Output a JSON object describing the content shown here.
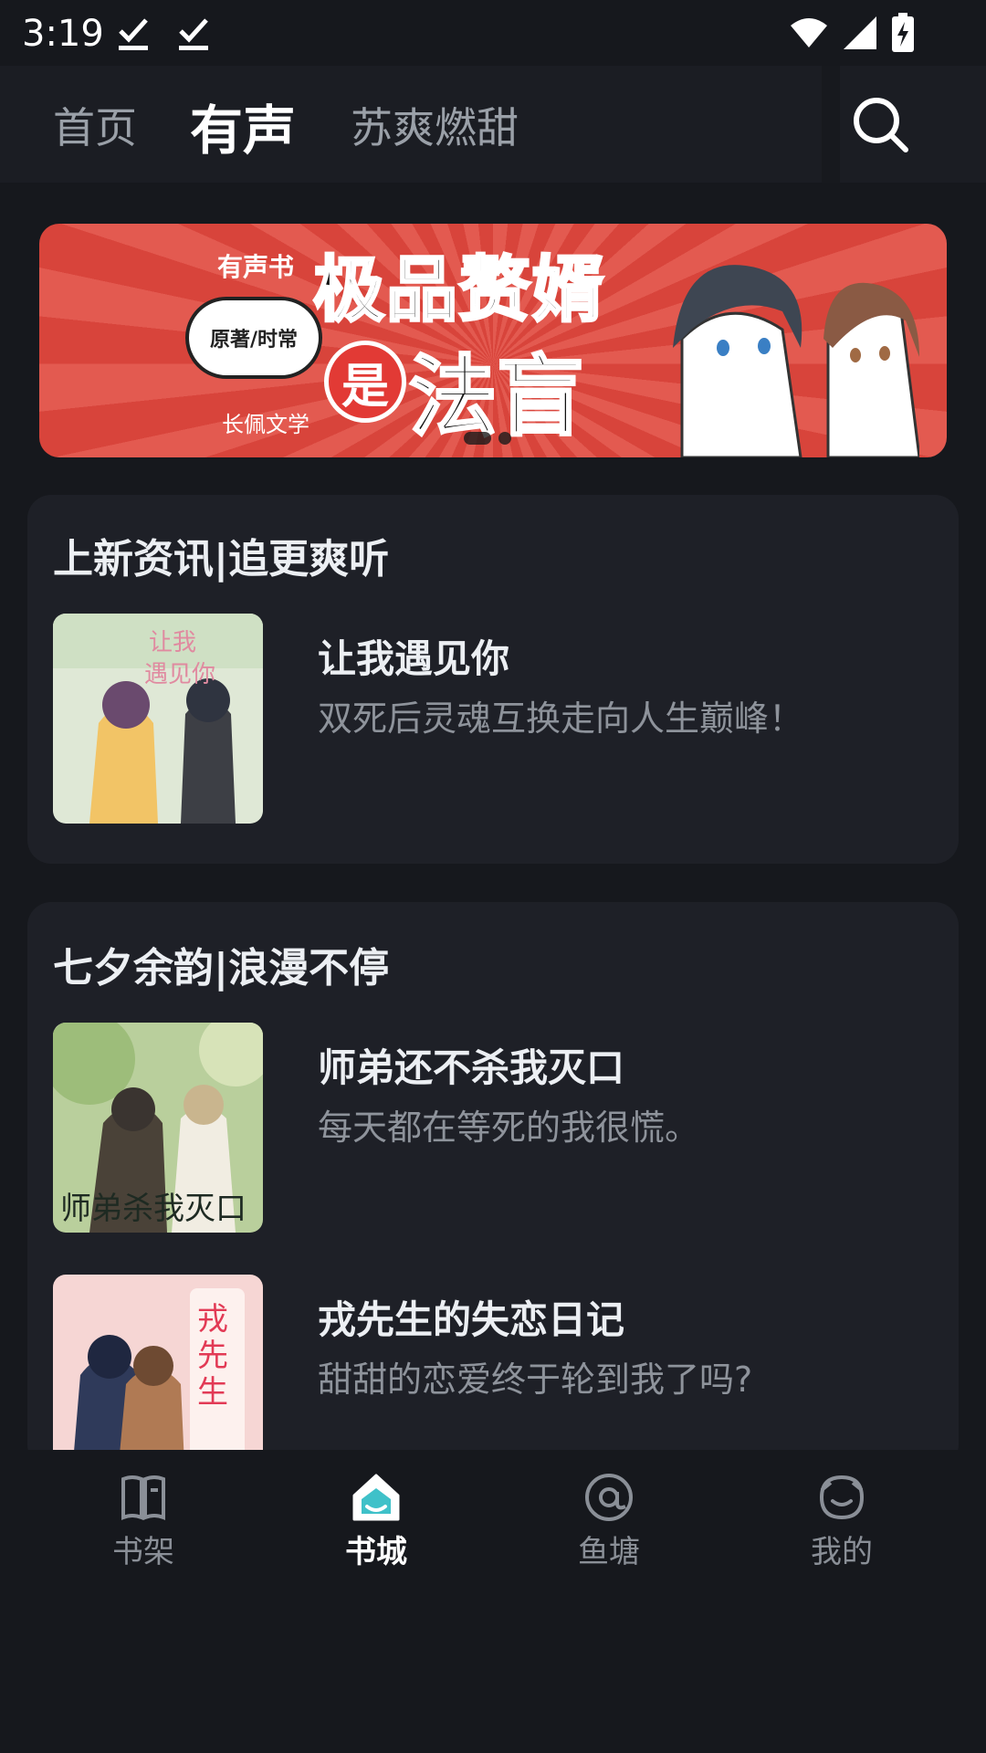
{
  "status_bar": {
    "time": "3:19"
  },
  "top_nav": {
    "tabs": [
      {
        "label": "首页",
        "active": false
      },
      {
        "label": "有声",
        "active": true
      },
      {
        "label": "苏爽燃甜",
        "active": false
      }
    ]
  },
  "banner": {
    "tag": "有声书",
    "author_note": "原著/时常",
    "title_line1": "极品赘婿",
    "badge": "是",
    "title_line2": "法盲",
    "publisher": "长佩文学",
    "slide_count": 2,
    "active_slide": 1
  },
  "sections": [
    {
      "title": "上新资讯|追更爽听",
      "books": [
        {
          "title": "让我遇见你",
          "desc": "双死后灵魂互换走向人生巅峰！"
        }
      ]
    },
    {
      "title": "七夕余韵|浪漫不停",
      "books": [
        {
          "title": "师弟还不杀我灭口",
          "desc": "每天都在等死的我很慌。"
        },
        {
          "title": "戎先生的失恋日记",
          "desc": "甜甜的恋爱终于轮到我了吗?"
        }
      ]
    }
  ],
  "bottom_nav": {
    "items": [
      {
        "label": "书架",
        "icon": "bookshelf-icon",
        "active": false
      },
      {
        "label": "书城",
        "icon": "bookstore-icon",
        "active": true
      },
      {
        "label": "鱼塘",
        "icon": "at-icon",
        "active": false
      },
      {
        "label": "我的",
        "icon": "profile-icon",
        "active": false
      }
    ]
  },
  "colors": {
    "accent": "#3fc1c9",
    "background": "#16181d",
    "card": "#1e2027"
  }
}
